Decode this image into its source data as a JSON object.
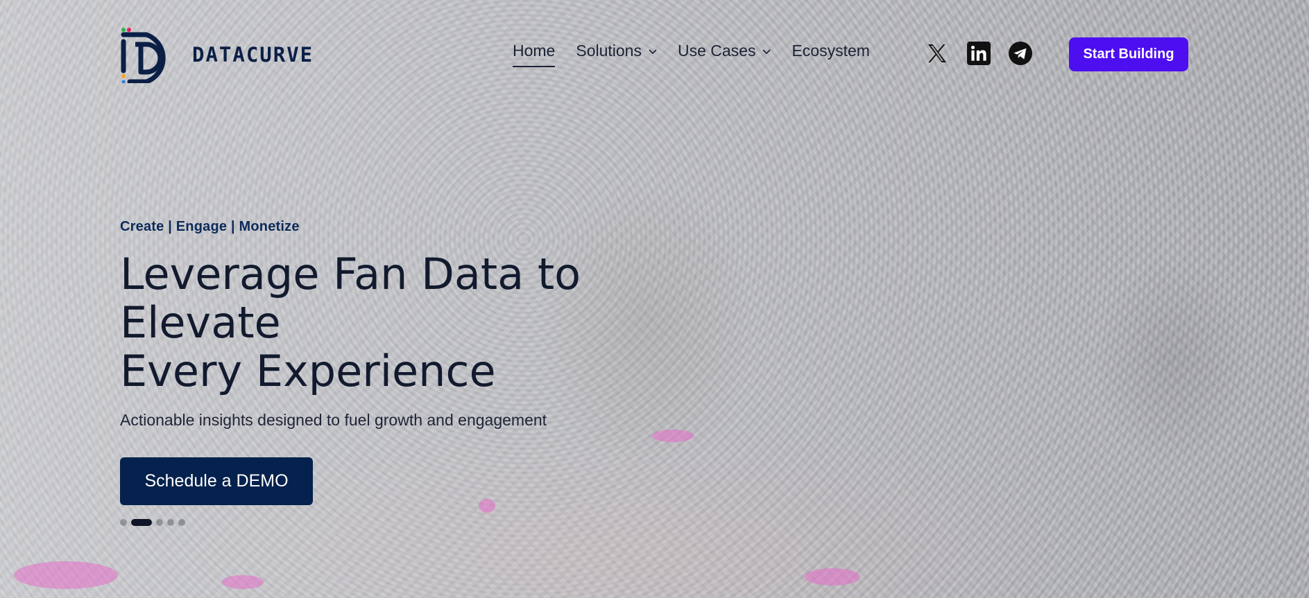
{
  "brand": {
    "name": "DATACURVE"
  },
  "nav": {
    "items": [
      {
        "label": "Home",
        "active": true,
        "has_dropdown": false
      },
      {
        "label": "Solutions",
        "active": false,
        "has_dropdown": true
      },
      {
        "label": "Use Cases",
        "active": false,
        "has_dropdown": true
      },
      {
        "label": "Ecosystem",
        "active": false,
        "has_dropdown": false
      }
    ]
  },
  "socials": [
    {
      "icon": "x-twitter-icon"
    },
    {
      "icon": "linkedin-icon"
    },
    {
      "icon": "telegram-icon"
    }
  ],
  "header": {
    "cta_label": "Start Building"
  },
  "hero": {
    "tagline": "Create | Engage | Monetize",
    "headline_line1": "Leverage Fan Data to Elevate",
    "headline_line2": "Every Experience",
    "subheadline": "Actionable insights designed to fuel growth and engagement",
    "cta_label": "Schedule a DEMO"
  },
  "carousel": {
    "slides": 5,
    "active_index": 1
  },
  "colors": {
    "primary_cta": "#4d0ff0",
    "demo_button": "#05214d",
    "brand_navy": "#0b1f46"
  }
}
